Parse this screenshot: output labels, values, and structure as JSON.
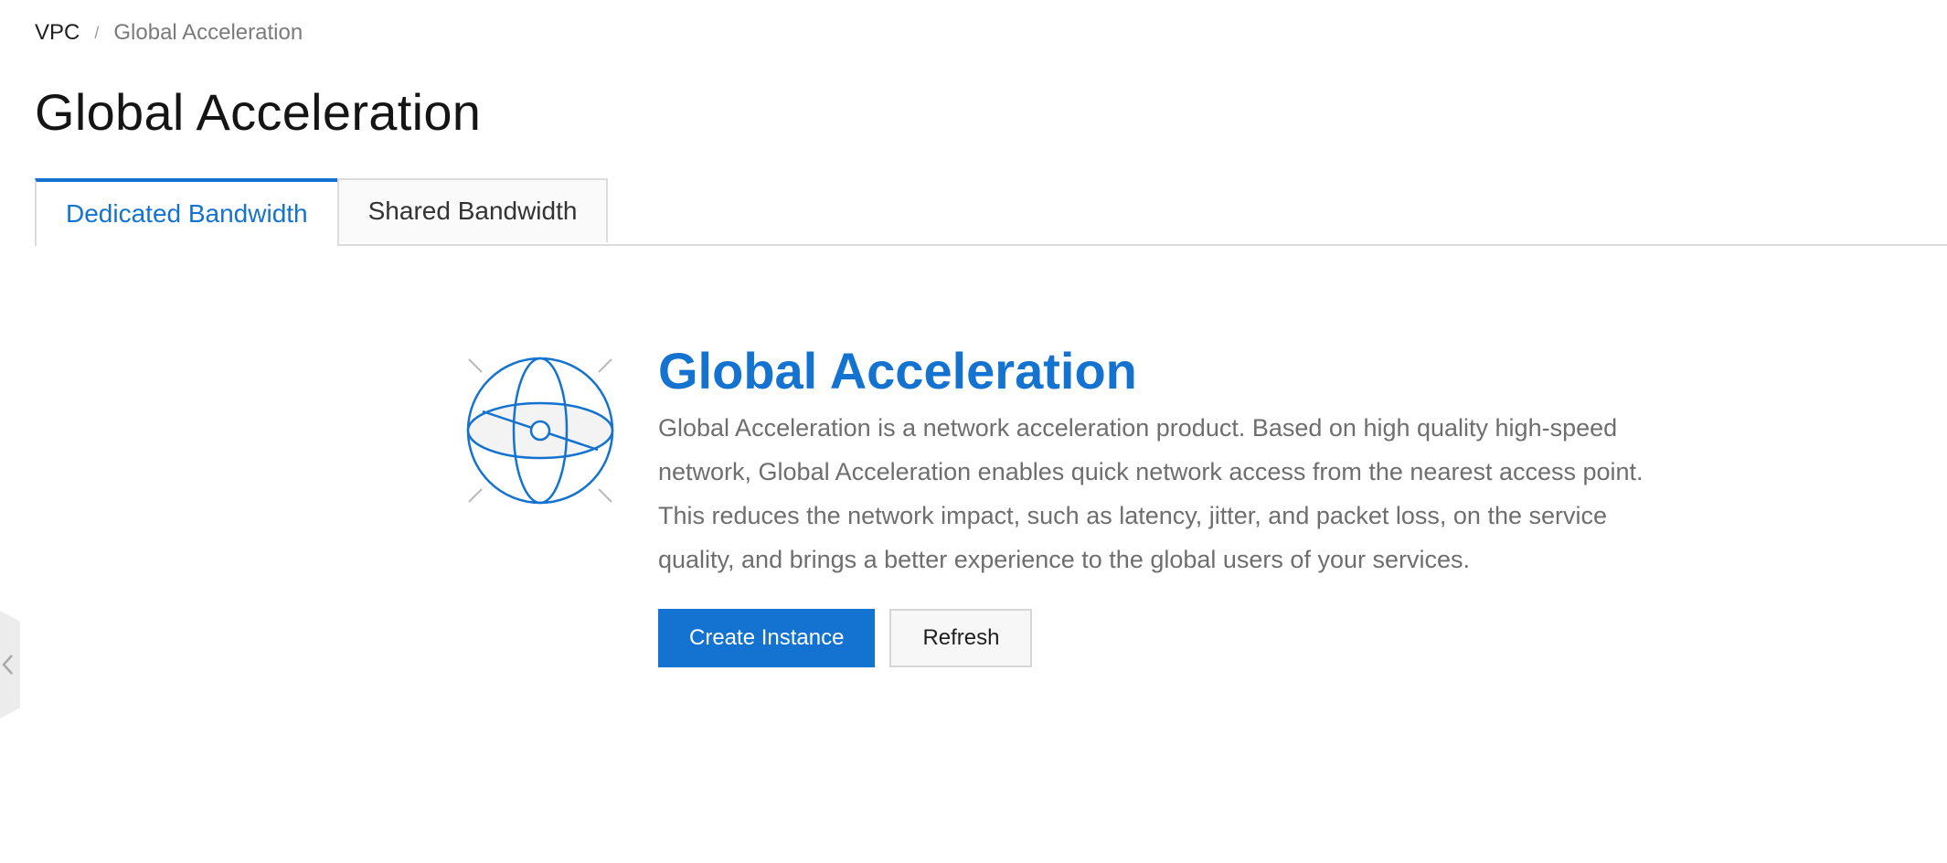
{
  "breadcrumb": {
    "root": "VPC",
    "separator": "/",
    "current": "Global Acceleration"
  },
  "page": {
    "title": "Global Acceleration"
  },
  "tabs": [
    {
      "label": "Dedicated Bandwidth",
      "active": true
    },
    {
      "label": "Shared Bandwidth",
      "active": false
    }
  ],
  "empty_state": {
    "icon": "globe-icon",
    "title": "Global Acceleration",
    "description": "Global Acceleration is a network acceleration product. Based on high quality high-speed network, Global Acceleration enables quick network access from the nearest access point. This reduces the network impact, such as latency, jitter, and packet loss, on the service quality, and brings a better experience to the global users of your services.",
    "buttons": {
      "create": "Create Instance",
      "refresh": "Refresh"
    }
  },
  "sidebar_toggle": {
    "icon": "chevron-left-icon"
  },
  "colors": {
    "accent": "#1473d0",
    "text_muted": "#6e6e6e",
    "border": "#dcdcdc"
  }
}
